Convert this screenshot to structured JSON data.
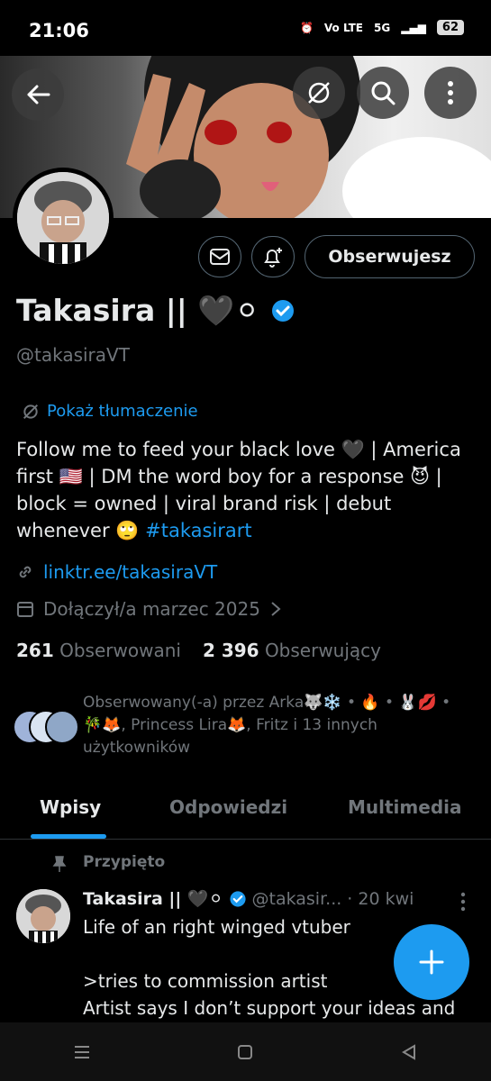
{
  "status_bar": {
    "time": "21:06",
    "network": "5G",
    "volte": "Vo LTE",
    "battery": "62"
  },
  "profile": {
    "name": "Takasira ||",
    "name_emoji": "🖤⚪",
    "handle": "@takasiraVT",
    "translate_label": "Pokaż tłumaczenie",
    "bio_main": "Follow me to feed your black love 🖤 | America first 🇺🇸 | DM the word boy for a response 😈 | block = owned | viral brand risk | debut whenever 🙄 ",
    "bio_hashtag": "#takasirart",
    "link": "linktr.ee/takasiraVT",
    "joined": "Dołączył/a marzec 2025",
    "following_count": "261",
    "following_label": "Obserwowani",
    "followers_count": "2 396",
    "followers_label": "Obserwujący",
    "followed_by": "Obserwowany(-a) przez Arka🐺❄️ • 🔥 • 🐰💋 • 🎋🦊, Princess Lira🦊, Fritz i 13 innych użytkowników"
  },
  "actions": {
    "follow_state": "Obserwujesz"
  },
  "tabs": [
    {
      "label": "Wpisy",
      "active": true
    },
    {
      "label": "Odpowiedzi",
      "active": false
    },
    {
      "label": "Multimedia",
      "active": false
    }
  ],
  "post": {
    "pinned_label": "Przypięto",
    "author": "Takasira || 🖤⚪",
    "handle": "@takasir...",
    "time": "· 20 kwi",
    "line1": "Life of an right winged vtuber",
    "line2": ">tries to commission artist",
    "line3": "Artist says I don’t support your ideas and"
  },
  "colors": {
    "accent": "#1d9bf0",
    "muted": "#71767b",
    "text": "#e7e9ea",
    "background": "#000000"
  }
}
